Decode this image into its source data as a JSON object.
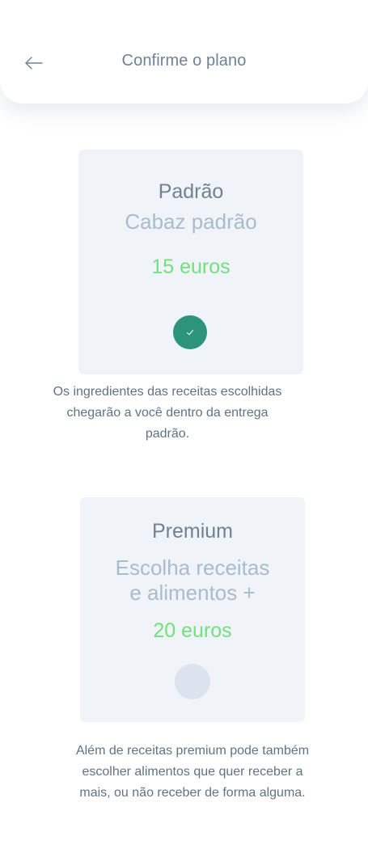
{
  "header": {
    "back_icon": "arrow-left-icon",
    "title": "Confirme o plano"
  },
  "plans": [
    {
      "name": "Padrão",
      "subtitle_lines": [
        "Cabaz padrão"
      ],
      "price": "15 euros",
      "selected": true,
      "description": "Os ingredientes das receitas escolhidas chegarão a você dentro da entrega padrão."
    },
    {
      "name": "Premium",
      "subtitle_lines": [
        "Escolha receitas",
        "e alimentos +"
      ],
      "price": "20 euros",
      "selected": false,
      "description": "Além de receitas premium pode também escolher alimentos que quer receber a mais, ou não receber de forma alguma."
    }
  ],
  "colors": {
    "card_background": "#f0f3f7",
    "price": "#72e07e",
    "selected_radio": "#2c9579",
    "unselected_radio": "#dde3ee",
    "title_text": "#6f8294",
    "subtitle_text": "#a9bccd"
  }
}
